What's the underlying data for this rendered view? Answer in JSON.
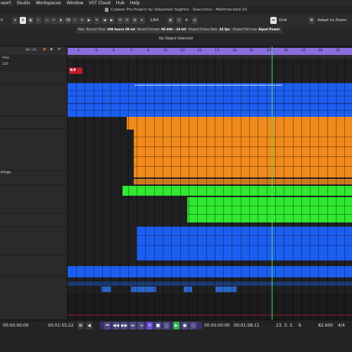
{
  "menubar": {
    "items": [
      "ssort",
      "Studio",
      "Workspaces",
      "Window",
      "VST Cloud",
      "Hub",
      "Help"
    ]
  },
  "window": {
    "title": "Cubase Pro Project by Sebastian Saghini - Giacchino - Meldmerized-19"
  },
  "toolbar": {
    "track_label": "h",
    "quantize_value": "1/64",
    "snap_mode": "A",
    "grid_label": "Grid",
    "zoom_label": "Adapt to Zoom"
  },
  "status_line": {
    "max_record_label": "Max. Record Time",
    "max_record_value": "194 hours 38 mins",
    "record_format_label": "Record Format",
    "record_format_value": "96 kHz - 24 bit",
    "frame_rate_label": "Project Frame Rate",
    "frame_rate_value": "24 fps",
    "pan_law_label": "Project Pan Law",
    "pan_law_value": "Equal Power"
  },
  "info_line": {
    "no_object": "No Object Selected"
  },
  "inspector": {
    "count": "38 / 41",
    "step_label": "Step",
    "step_value": "220",
    "track_name": "trings"
  },
  "ruler": {
    "bars": [
      "1",
      "3",
      "5",
      "7",
      "9",
      "11",
      "13",
      "15",
      "17",
      "19",
      "21",
      "23",
      "25",
      "27",
      "29",
      "31"
    ]
  },
  "arrange": {
    "signature": "4/4"
  },
  "transport": {
    "left_time": "00:00:00:00",
    "primary_time": "00:01:55:22",
    "left_locator": "00:00:00:00",
    "right_locator": "00:01:08:11",
    "position_bars": "23. 3. 3.",
    "position_ticks": "6",
    "tempo": "82.600",
    "signature": "4/4"
  },
  "colors": {
    "ruler": "#8b6de0",
    "blue_parts": "#1c5ef0",
    "orange_parts": "#f08a1c",
    "green_parts": "#2fe82f",
    "cursor": "#3ee05a",
    "signature_marker": "#c41a2a"
  }
}
